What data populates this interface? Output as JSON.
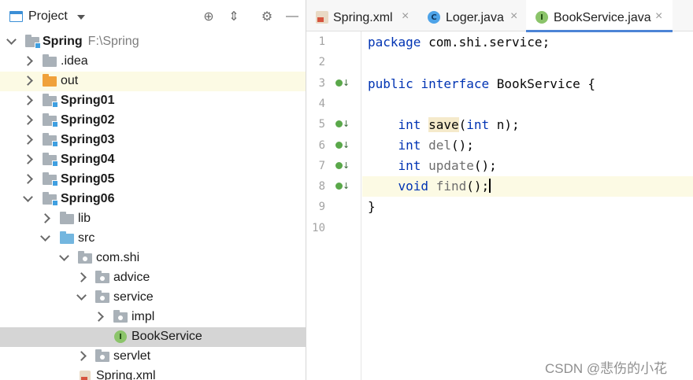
{
  "project_panel": {
    "title": "Project",
    "tree": [
      {
        "label": "Spring",
        "path": "F:\\Spring",
        "bold": true,
        "expanded": true
      },
      {
        "label": ".idea"
      },
      {
        "label": "out"
      },
      {
        "label": "Spring01",
        "bold": true
      },
      {
        "label": "Spring02",
        "bold": true
      },
      {
        "label": "Spring03",
        "bold": true
      },
      {
        "label": "Spring04",
        "bold": true
      },
      {
        "label": "Spring05",
        "bold": true
      },
      {
        "label": "Spring06",
        "bold": true,
        "expanded": true
      },
      {
        "label": "lib"
      },
      {
        "label": "src",
        "expanded": true
      },
      {
        "label": "com.shi",
        "expanded": true
      },
      {
        "label": "advice"
      },
      {
        "label": "service",
        "expanded": true
      },
      {
        "label": "impl"
      },
      {
        "label": "BookService",
        "selected": true
      },
      {
        "label": "servlet"
      },
      {
        "label": "Spring.xml"
      }
    ]
  },
  "editor": {
    "tabs": [
      {
        "label": "Spring.xml",
        "icon": "xml-file-icon"
      },
      {
        "label": "Loger.java",
        "icon": "class-icon"
      },
      {
        "label": "BookService.java",
        "icon": "interface-icon",
        "active": true
      }
    ],
    "line_numbers": [
      "1",
      "2",
      "3",
      "4",
      "5",
      "6",
      "7",
      "8",
      "9",
      "10"
    ],
    "code": {
      "l1_kw": "package",
      "l1_rest": " com.shi.service;",
      "l3_kw1": "public",
      "l3_kw2": "interface",
      "l3_rest": " BookService {",
      "l5_kw": "int",
      "l5_fn": "save",
      "l5_open": "(",
      "l5_kw2": "int",
      "l5_rest": " n);",
      "l6_kw": "int",
      "l6_fn": "del",
      "l6_rest": "();",
      "l7_kw": "int",
      "l7_fn": "update",
      "l7_rest": "();",
      "l8_kw": "void",
      "l8_fn": "find",
      "l8_rest": "();",
      "l9": "}"
    }
  },
  "watermark": "CSDN @悲伤的小花",
  "colors": {
    "keyword": "#0033b3",
    "current_line": "#fcfae4",
    "selection": "#d5d5d5",
    "tab_underline": "#4c84d6"
  }
}
